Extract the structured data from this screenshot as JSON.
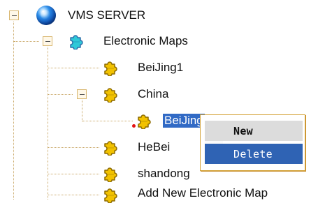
{
  "tree": {
    "root_label": "VMS SERVER",
    "maps_label": "Electronic Maps",
    "items": [
      {
        "label": "BeiJing1"
      },
      {
        "label": "China"
      },
      {
        "label": "BeiJing"
      },
      {
        "label": "HeBei"
      },
      {
        "label": "shandong"
      },
      {
        "label": "Add New Electronic Map"
      }
    ]
  },
  "context_menu": {
    "new_label": "New",
    "delete_label": "Delete"
  },
  "icons": {
    "root": "globe-icon",
    "maps": "puzzle-icon",
    "item": "puzzle-icon",
    "warning": "red-dot-icon"
  },
  "colors": {
    "selected_bg": "#316ac5",
    "menu_highlight": "#2f63b4",
    "menu_secondary": "#dcdcdc",
    "tree_line": "#caa96a",
    "puzzle_yellow": "#f2c200"
  }
}
